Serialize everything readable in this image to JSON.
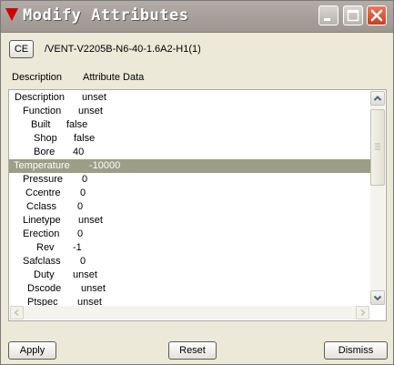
{
  "window": {
    "title": "Modify Attributes"
  },
  "ce_button": "CE",
  "element_path": "/VENT-V2205B-N6-40-1.6A2-H1(1)",
  "headers": {
    "description": "Description",
    "attribute_data": "Attribute Data"
  },
  "attributes": [
    {
      "name": "Description",
      "value": "unset"
    },
    {
      "name": "Function",
      "value": "unset"
    },
    {
      "name": "Built",
      "value": "false"
    },
    {
      "name": "Shop",
      "value": "false"
    },
    {
      "name": "Bore",
      "value": "40"
    },
    {
      "name": "Temperature",
      "value": "-10000",
      "selected": true
    },
    {
      "name": "Pressure",
      "value": "0"
    },
    {
      "name": "Ccentre",
      "value": "0"
    },
    {
      "name": "Cclass",
      "value": "0"
    },
    {
      "name": "Linetype",
      "value": "unset"
    },
    {
      "name": "Erection",
      "value": "0"
    },
    {
      "name": "Rev",
      "value": "-1"
    },
    {
      "name": "Safclass",
      "value": "0"
    },
    {
      "name": "Duty",
      "value": "unset"
    },
    {
      "name": "Dscode",
      "value": "unset"
    },
    {
      "name": "Ptspec",
      "value": "unset"
    }
  ],
  "buttons": {
    "apply": "Apply",
    "reset": "Reset",
    "dismiss": "Dismiss"
  },
  "colors": {
    "title_icon": "#d40000",
    "selection": "#9c9e87",
    "dialog_bg": "#ECE9D8"
  }
}
